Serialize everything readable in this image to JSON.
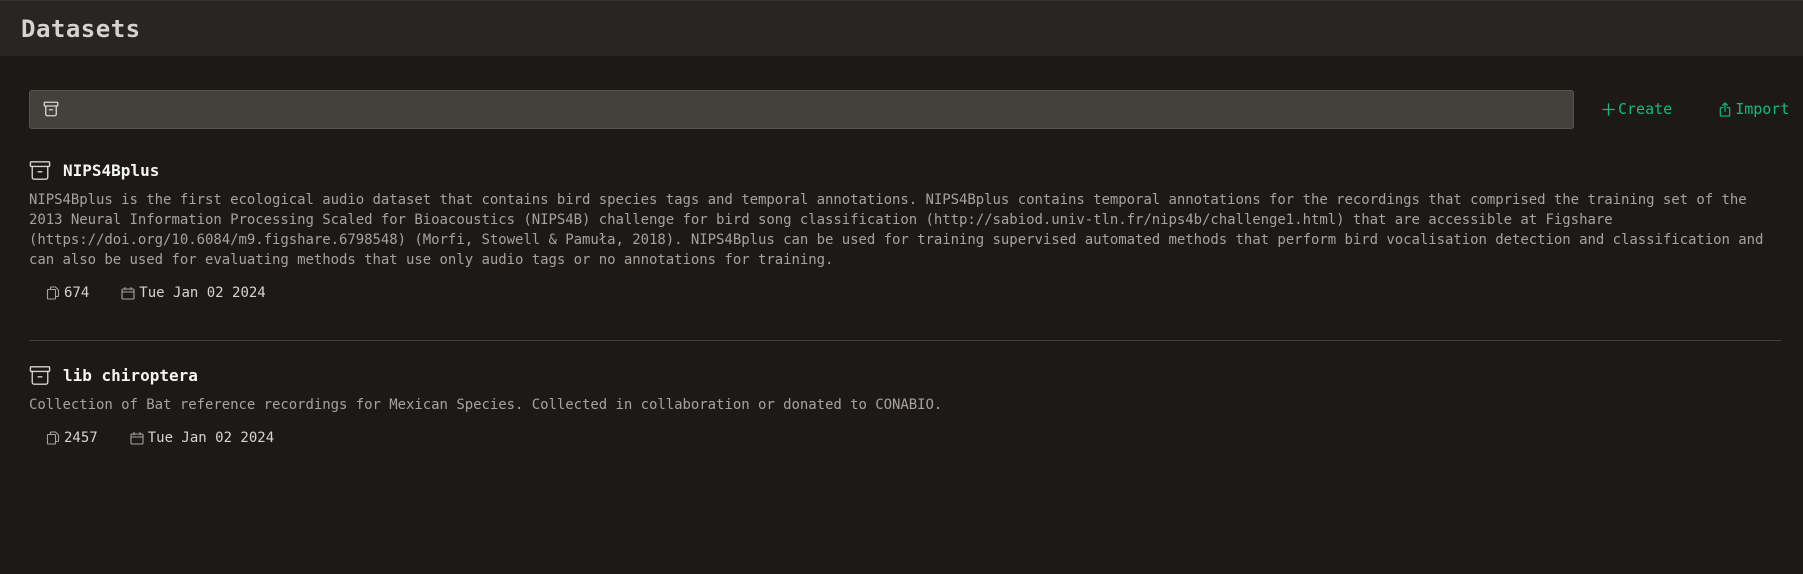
{
  "header": {
    "title": "Datasets"
  },
  "search": {
    "icon": "archive-icon",
    "value": "",
    "placeholder": ""
  },
  "actions": {
    "create_label": "Create",
    "create_icon": "plus-icon",
    "import_label": "Import",
    "import_icon": "upload-icon"
  },
  "datasets": [
    {
      "name": "NIPS4Bplus",
      "description": "NIPS4Bplus is the first ecological audio dataset that contains bird species tags and temporal annotations. NIPS4Bplus contains temporal annotations for the recordings that comprised the training set of the 2013 Neural Information Processing Scaled for Bioacoustics (NIPS4B) challenge for bird song classification (http://sabiod.univ-tln.fr/nips4b/challenge1.html) that are accessible at Figshare (https://doi.org/10.6084/m9.figshare.6798548) (Morfi, Stowell & Pamuła, 2018). NIPS4Bplus can be used for training supervised automated methods that perform bird vocalisation detection and classification and can also be used for evaluating methods that use only audio tags or no annotations for training.",
      "count": "674",
      "date": "Tue Jan 02 2024"
    },
    {
      "name": "lib chiroptera",
      "description": "Collection of Bat reference recordings for Mexican Species. Collected in collaboration or donated to CONABIO.",
      "count": "2457",
      "date": "Tue Jan 02 2024"
    }
  ],
  "colors": {
    "background": "#1c1917",
    "header": "#292524",
    "accent": "#10b981",
    "search_bg": "#44403c"
  }
}
